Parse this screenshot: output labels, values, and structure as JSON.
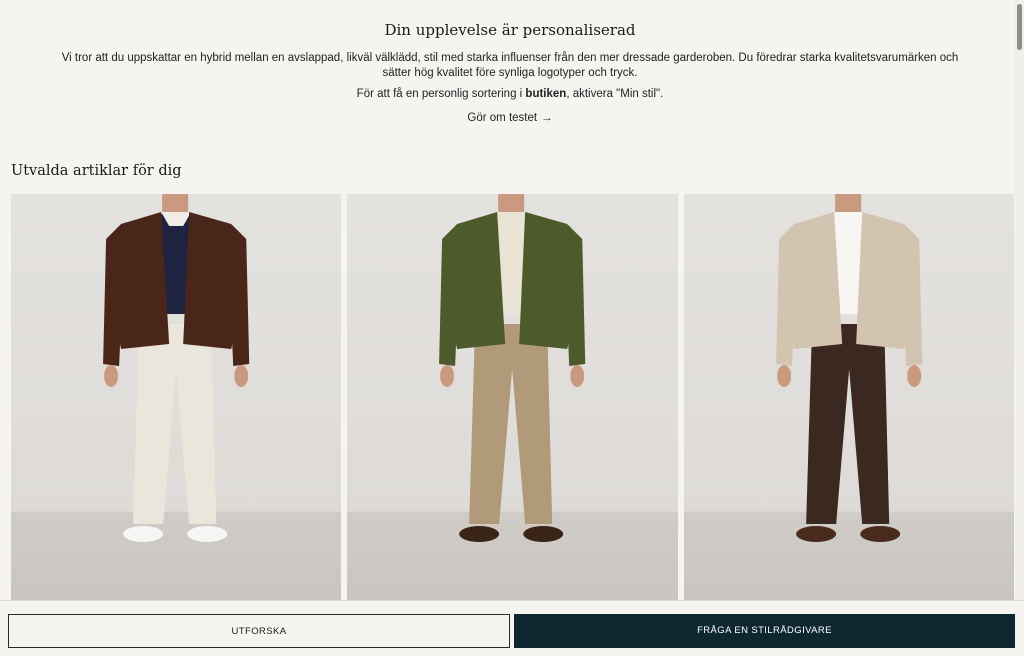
{
  "intro": {
    "title": "Din upplevelse är personaliserad",
    "description": "Vi tror att du uppskattar en hybrid mellan en avslappad, likväl välklädd, stil med starka influenser från den mer dressade garderoben. Du föredrar starka kvalitetsvarumärken och sätter hög kvalitet före synliga logotyper och tryck.",
    "cta_prefix": "För att få en personlig sortering i ",
    "cta_bold": "butiken",
    "cta_suffix": ", aktivera \"Min stil\".",
    "redo_label": "Gör om testet",
    "redo_arrow": "→"
  },
  "section": {
    "heading": "Utvalda artiklar för dig"
  },
  "products": [
    {
      "jacket_color": "#4a2519",
      "top_color": "#1d2340",
      "pants_color": "#ebe6dc",
      "shoe_color": "#f6f6f4",
      "collar_color": "#f0ede6"
    },
    {
      "jacket_color": "#4c5a2c",
      "top_color": "#e9e3d4",
      "pants_color": "#b19a7a",
      "shoe_color": "#3a2418",
      "collar_color": "#e9e3d4"
    },
    {
      "jacket_color": "#d3c4b2",
      "top_color": "#f7f6f2",
      "pants_color": "#3b2820",
      "shoe_color": "#4a2a1c",
      "collar_color": "#f7f6f2"
    }
  ],
  "bottom_bar": {
    "explore_label": "UTFORSKA",
    "advisor_label": "FRÅGA EN STILRÅDGIVARE"
  },
  "colors": {
    "background": "#f5f4f1",
    "advisor_button": "#0d2630"
  }
}
